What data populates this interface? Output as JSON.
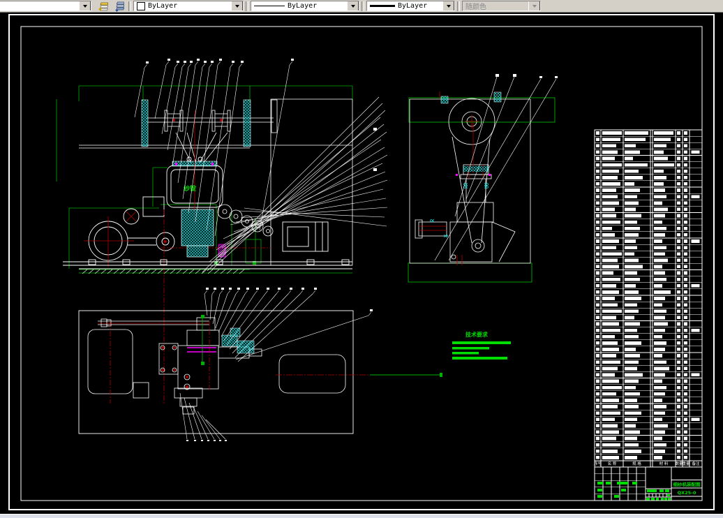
{
  "toolbar": {
    "layer_combo": {
      "value": ""
    },
    "color_combo": {
      "value": "ByLayer"
    },
    "linetype_combo": {
      "value": "ByLayer"
    },
    "lineweight_combo": {
      "value": "ByLayer"
    },
    "plotstyle_combo": {
      "value": "随颜色",
      "disabled": true
    }
  },
  "drawing": {
    "colors": {
      "line": "#ffffff",
      "dim_green": "#00b000",
      "text_green": "#00dd00",
      "centerline_red": "#b00000",
      "hatch_cyan": "#00e5e5",
      "hatch_magenta": "#ff00ff"
    },
    "view1_label": "纱锭",
    "tech_req": {
      "title": "技术要求"
    },
    "titleblock": {
      "drawing_name": "细纱机装配图",
      "drawing_no": "QX25-0"
    },
    "bom": {
      "header": [
        "序号",
        "名 称",
        "规 格",
        "材 料",
        "数量",
        "重量",
        "备注"
      ],
      "rows": [
        [
          28,
          34,
          28
        ],
        [
          26,
          30,
          24
        ],
        [
          20,
          16,
          18
        ],
        [
          22,
          22,
          14
        ],
        [
          18,
          12,
          20
        ],
        [
          28,
          33,
          30
        ],
        [
          24,
          20,
          14
        ],
        [
          22,
          26,
          18
        ],
        [
          26,
          14,
          14
        ],
        [
          20,
          22,
          16
        ],
        [
          22,
          18,
          18
        ],
        [
          24,
          20,
          12
        ],
        [
          18,
          16,
          20
        ],
        [
          20,
          24,
          16
        ],
        [
          26,
          18,
          12
        ],
        [
          14,
          22,
          18
        ],
        [
          18,
          20,
          16
        ],
        [
          24,
          16,
          12
        ],
        [
          20,
          18,
          18
        ],
        [
          28,
          14,
          16
        ],
        [
          22,
          20,
          20
        ],
        [
          24,
          26,
          12
        ],
        [
          16,
          18,
          16
        ],
        [
          26,
          22,
          18
        ],
        [
          20,
          16,
          12
        ],
        [
          24,
          20,
          24
        ],
        [
          18,
          24,
          16
        ],
        [
          22,
          18,
          12
        ],
        [
          28,
          20,
          18
        ],
        [
          20,
          14,
          16
        ],
        [
          24,
          22,
          20
        ],
        [
          26,
          18,
          16
        ],
        [
          18,
          20,
          12
        ],
        [
          22,
          24,
          18
        ],
        [
          24,
          16,
          16
        ],
        [
          20,
          22,
          12
        ],
        [
          26,
          20,
          18
        ],
        [
          22,
          18,
          22
        ],
        [
          18,
          26,
          16
        ],
        [
          24,
          20,
          12
        ],
        [
          28,
          16,
          18
        ],
        [
          20,
          22,
          16
        ],
        [
          24,
          18,
          12
        ],
        [
          22,
          20,
          18
        ],
        [
          26,
          24,
          16
        ],
        [
          18,
          18,
          12
        ],
        [
          22,
          16,
          20
        ],
        [
          24,
          22,
          16
        ],
        [
          20,
          18,
          12
        ],
        [
          26,
          20,
          18
        ],
        [
          22,
          24,
          16
        ],
        [
          24,
          18,
          12
        ]
      ]
    }
  }
}
